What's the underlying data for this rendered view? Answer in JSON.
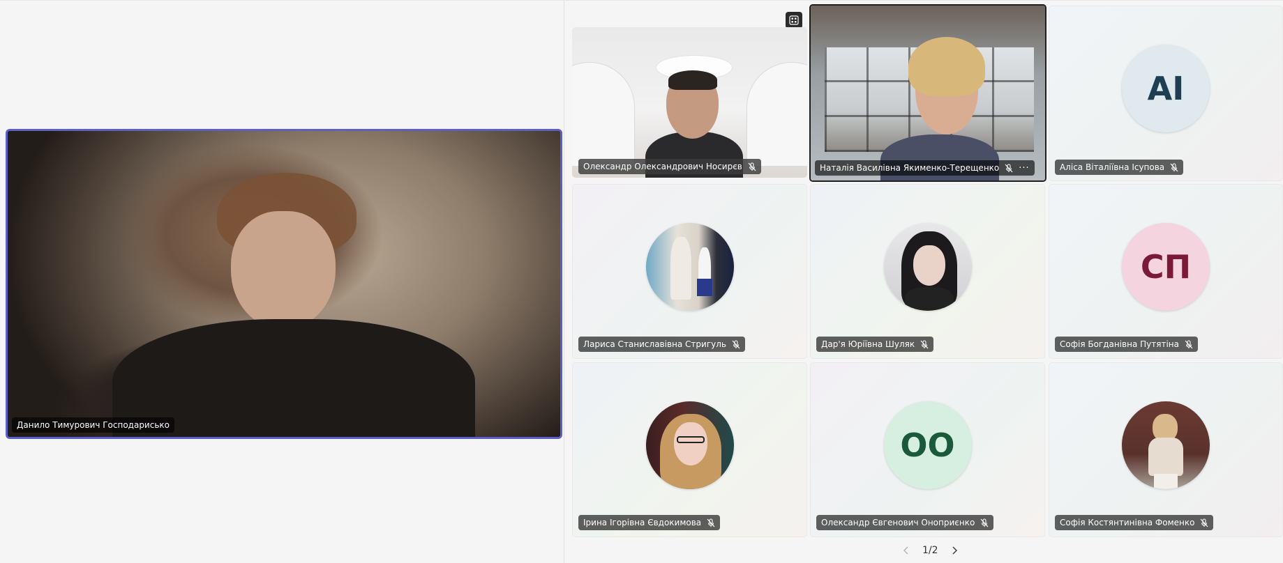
{
  "spotlight": {
    "name": "Данило Тимурович Господарисько"
  },
  "grid": {
    "tiles": [
      {
        "name": "Олександр Олександрович Носирєв",
        "type": "video",
        "muted": true
      },
      {
        "name": "Наталія Василівна Якименко-Терещенко",
        "type": "video",
        "muted": true,
        "active_speaker": true,
        "more_label": "···"
      },
      {
        "name": "Аліса Віталіївна Ісупова",
        "type": "initials",
        "initials": "АІ",
        "avatar_bg": "#dfe9ee",
        "avatar_fg": "#1e3f52",
        "muted": true
      },
      {
        "name": "Лариса Станиславівна Стригуль",
        "type": "photo",
        "muted": true
      },
      {
        "name": "Дар'я Юріївна Шуляк",
        "type": "photo",
        "muted": true
      },
      {
        "name": "Софія Богданівна Путятіна",
        "type": "initials",
        "initials": "СП",
        "avatar_bg": "#f4d4de",
        "avatar_fg": "#7a1a38",
        "muted": true
      },
      {
        "name": "Ірина Ігорівна Євдокимова",
        "type": "photo",
        "muted": true
      },
      {
        "name": "Олександр Євгенович Оноприєнко",
        "type": "initials",
        "initials": "ОО",
        "avatar_bg": "#d6efe1",
        "avatar_fg": "#1a5a3a",
        "muted": true
      },
      {
        "name": "Софія Костянтинівна Фоменко",
        "type": "photo",
        "muted": true
      }
    ]
  },
  "pager": {
    "label": "1/2",
    "prev_icon": "chevron-left-icon",
    "next_icon": "chevron-right-icon"
  },
  "toolbar": {
    "layout_icon": "grid-layout-icon"
  },
  "colors": {
    "spotlight_border": "#5b5fc7",
    "active_speaker_border": "#1f1f1f"
  }
}
